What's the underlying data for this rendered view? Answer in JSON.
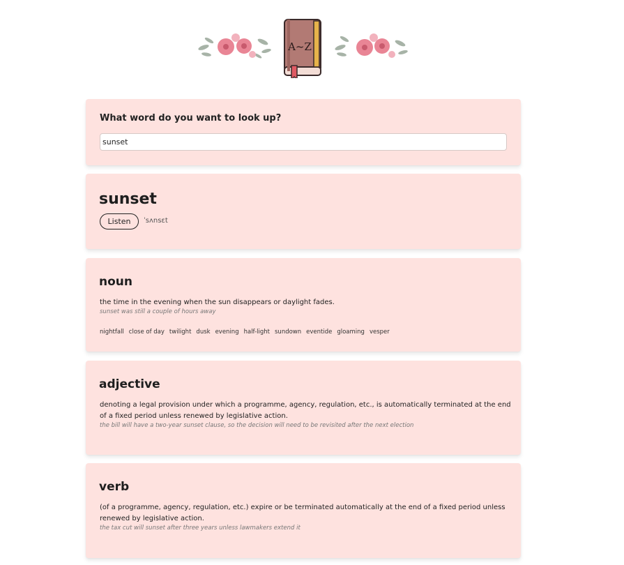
{
  "search": {
    "question": "What word do you want to look up?",
    "value": "sunset"
  },
  "word": {
    "title": "sunset",
    "listen_label": "Listen",
    "phonetic": "ˈsʌnsɛt"
  },
  "meanings": [
    {
      "part_of_speech": "noun",
      "definition": "the time in the evening when the sun disappears or daylight fades.",
      "example": "sunset was still a couple of hours away",
      "synonyms": [
        "nightfall",
        "close of day",
        "twilight",
        "dusk",
        "evening",
        "half-light",
        "sundown",
        "eventide",
        "gloaming",
        "vesper"
      ]
    },
    {
      "part_of_speech": "adjective",
      "definition": "denoting a legal provision under which a programme, agency, regulation, etc., is automatically terminated at the end of a fixed period unless renewed by legislative action.",
      "example": "the bill will have a two-year sunset clause, so the decision will need to be revisited after the next election"
    },
    {
      "part_of_speech": "verb",
      "definition": "(of a programme, agency, regulation, etc.) expire or be terminated automatically at the end of a fixed period unless renewed by legislative action.",
      "example": "the tax cut will sunset after three years unless lawmakers extend it"
    }
  ],
  "icons": {
    "logo": "dictionary-book-icon",
    "decoration": "flower-decoration"
  },
  "colors": {
    "card_background": "#fee2df",
    "book_cover": "#b27a74",
    "book_accent": "#e7b34b",
    "bookmark": "#e05a63"
  }
}
